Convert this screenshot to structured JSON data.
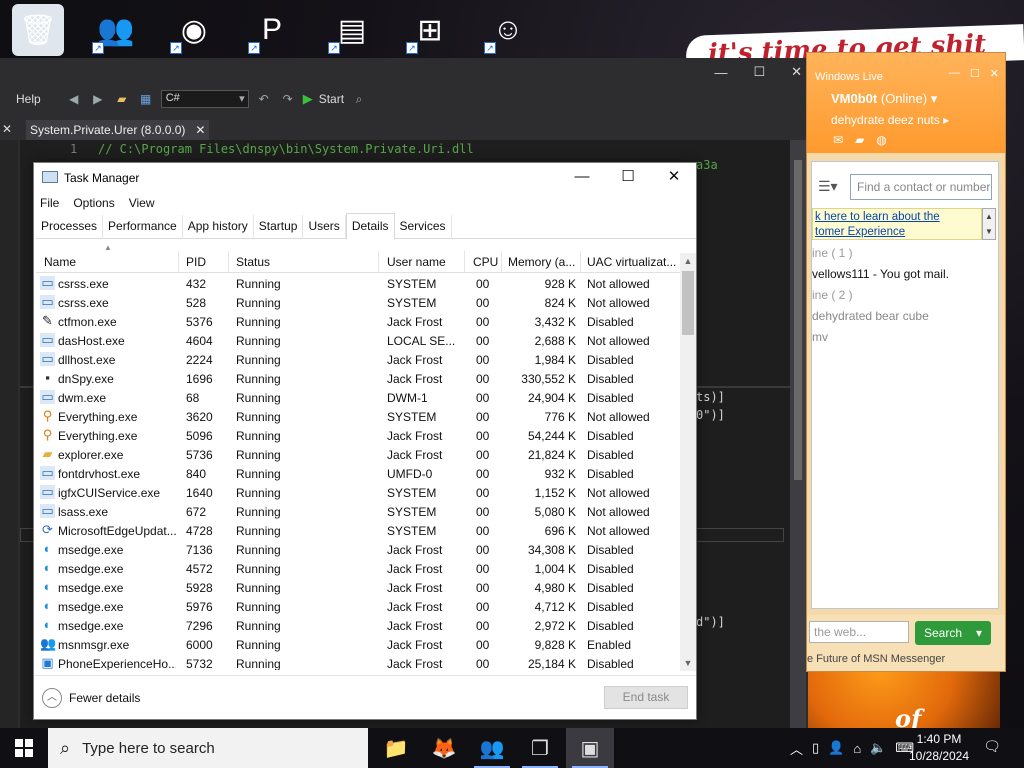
{
  "desktop": {
    "icons": [
      {
        "name": "recycle-bin-icon",
        "glyph": "🗑",
        "bg": "#dfe6ee"
      },
      {
        "name": "msn-messenger-icon",
        "glyph": "👥",
        "bg": "transparent"
      },
      {
        "name": "chrome-icon",
        "glyph": "◉",
        "bg": "transparent"
      },
      {
        "name": "app-p-icon",
        "glyph": "P",
        "bg": "transparent"
      },
      {
        "name": "winrar-icon",
        "glyph": "▤",
        "bg": "transparent"
      },
      {
        "name": "windows-icon",
        "glyph": "⊞",
        "bg": "transparent"
      },
      {
        "name": "character-icon",
        "glyph": "☺",
        "bg": "transparent"
      }
    ],
    "banner_text": "it's time to get shit",
    "pumpkin_text": "of"
  },
  "dnspy": {
    "menu_help": "Help",
    "language": "C#",
    "start_label": "Start",
    "doc_tab": "System.Private.Urer (8.0.0.0)",
    "line_number": "1",
    "comment": "// C:\\Program Files\\dnspy\\bin\\System.Private.Uri.dll",
    "code_fragments": [
      "a3a",
      "ts)]",
      "0\")]",
      "d\")]"
    ]
  },
  "msn": {
    "window_title": "Windows Live",
    "user_name": "VM0b0t",
    "status": "(Online)",
    "personal_message": "dehydrate deez nuts",
    "search_placeholder": "Find a contact or number",
    "ad_line1": "k here to learn about the",
    "ad_line2": "tomer Experience",
    "group_online": "ine ( 1 )",
    "contact_online": "vellows111 - You got mail.",
    "group_offline": "ine ( 2 )",
    "contact_off1": "dehydrated bear cube",
    "contact_off2": "mv",
    "web_search_placeholder": "the web...",
    "search_button": "Search",
    "future_text": "e Future of MSN Messenger"
  },
  "taskmanager": {
    "title": "Task Manager",
    "menu": [
      "File",
      "Options",
      "View"
    ],
    "tabs": [
      "Processes",
      "Performance",
      "App history",
      "Startup",
      "Users",
      "Details",
      "Services"
    ],
    "active_tab": "Details",
    "columns": {
      "name": "Name",
      "pid": "PID",
      "status": "Status",
      "user": "User name",
      "cpu": "CPU",
      "memory": "Memory (a...",
      "uac": "UAC virtualizat..."
    },
    "rows": [
      {
        "name": "csrss.exe",
        "pid": "432",
        "status": "Running",
        "user": "SYSTEM",
        "cpu": "00",
        "mem": "928 K",
        "uac": "Not allowed",
        "icon": "sys"
      },
      {
        "name": "csrss.exe",
        "pid": "528",
        "status": "Running",
        "user": "SYSTEM",
        "cpu": "00",
        "mem": "824 K",
        "uac": "Not allowed",
        "icon": "sys"
      },
      {
        "name": "ctfmon.exe",
        "pid": "5376",
        "status": "Running",
        "user": "Jack Frost",
        "cpu": "00",
        "mem": "3,432 K",
        "uac": "Disabled",
        "icon": "pen"
      },
      {
        "name": "dasHost.exe",
        "pid": "4604",
        "status": "Running",
        "user": "LOCAL SE...",
        "cpu": "00",
        "mem": "2,688 K",
        "uac": "Not allowed",
        "icon": "sys"
      },
      {
        "name": "dllhost.exe",
        "pid": "2224",
        "status": "Running",
        "user": "Jack Frost",
        "cpu": "00",
        "mem": "1,984 K",
        "uac": "Disabled",
        "icon": "sys"
      },
      {
        "name": "dnSpy.exe",
        "pid": "1696",
        "status": "Running",
        "user": "Jack Frost",
        "cpu": "00",
        "mem": "330,552 K",
        "uac": "Disabled",
        "icon": "dnspy"
      },
      {
        "name": "dwm.exe",
        "pid": "68",
        "status": "Running",
        "user": "DWM-1",
        "cpu": "00",
        "mem": "24,904 K",
        "uac": "Disabled",
        "icon": "sys"
      },
      {
        "name": "Everything.exe",
        "pid": "3620",
        "status": "Running",
        "user": "SYSTEM",
        "cpu": "00",
        "mem": "776 K",
        "uac": "Not allowed",
        "icon": "search"
      },
      {
        "name": "Everything.exe",
        "pid": "5096",
        "status": "Running",
        "user": "Jack Frost",
        "cpu": "00",
        "mem": "54,244 K",
        "uac": "Disabled",
        "icon": "search"
      },
      {
        "name": "explorer.exe",
        "pid": "5736",
        "status": "Running",
        "user": "Jack Frost",
        "cpu": "00",
        "mem": "21,824 K",
        "uac": "Disabled",
        "icon": "folder"
      },
      {
        "name": "fontdrvhost.exe",
        "pid": "840",
        "status": "Running",
        "user": "UMFD-0",
        "cpu": "00",
        "mem": "932 K",
        "uac": "Disabled",
        "icon": "sys"
      },
      {
        "name": "igfxCUIService.exe",
        "pid": "1640",
        "status": "Running",
        "user": "SYSTEM",
        "cpu": "00",
        "mem": "1,152 K",
        "uac": "Not allowed",
        "icon": "sys"
      },
      {
        "name": "lsass.exe",
        "pid": "672",
        "status": "Running",
        "user": "SYSTEM",
        "cpu": "00",
        "mem": "5,080 K",
        "uac": "Not allowed",
        "icon": "sys"
      },
      {
        "name": "MicrosoftEdgeUpdat...",
        "pid": "4728",
        "status": "Running",
        "user": "SYSTEM",
        "cpu": "00",
        "mem": "696 K",
        "uac": "Not allowed",
        "icon": "update"
      },
      {
        "name": "msedge.exe",
        "pid": "7136",
        "status": "Running",
        "user": "Jack Frost",
        "cpu": "00",
        "mem": "34,308 K",
        "uac": "Disabled",
        "icon": "edge"
      },
      {
        "name": "msedge.exe",
        "pid": "4572",
        "status": "Running",
        "user": "Jack Frost",
        "cpu": "00",
        "mem": "1,004 K",
        "uac": "Disabled",
        "icon": "edge"
      },
      {
        "name": "msedge.exe",
        "pid": "5928",
        "status": "Running",
        "user": "Jack Frost",
        "cpu": "00",
        "mem": "4,980 K",
        "uac": "Disabled",
        "icon": "edge"
      },
      {
        "name": "msedge.exe",
        "pid": "5976",
        "status": "Running",
        "user": "Jack Frost",
        "cpu": "00",
        "mem": "4,712 K",
        "uac": "Disabled",
        "icon": "edge"
      },
      {
        "name": "msedge.exe",
        "pid": "7296",
        "status": "Running",
        "user": "Jack Frost",
        "cpu": "00",
        "mem": "2,972 K",
        "uac": "Disabled",
        "icon": "edge"
      },
      {
        "name": "msnmsgr.exe",
        "pid": "6000",
        "status": "Running",
        "user": "Jack Frost",
        "cpu": "00",
        "mem": "9,828 K",
        "uac": "Enabled",
        "icon": "msn"
      },
      {
        "name": "PhoneExperienceHo...",
        "pid": "5732",
        "status": "Running",
        "user": "Jack Frost",
        "cpu": "00",
        "mem": "25,184 K",
        "uac": "Disabled",
        "icon": "phone"
      }
    ],
    "fewer_details": "Fewer details",
    "end_task": "End task"
  },
  "taskbar": {
    "search_placeholder": "Type here to search",
    "apps": [
      {
        "name": "file-explorer-icon",
        "glyph": "📁",
        "running": false,
        "active": false
      },
      {
        "name": "firefox-icon",
        "glyph": "🦊",
        "running": false,
        "active": false
      },
      {
        "name": "msn-taskbar-icon",
        "glyph": "👥",
        "running": true,
        "active": false
      },
      {
        "name": "task-view-icon",
        "glyph": "❐",
        "running": true,
        "active": false
      },
      {
        "name": "task-manager-taskbar-icon",
        "glyph": "▣",
        "running": true,
        "active": true
      }
    ],
    "time": "1:40 PM",
    "date": "10/28/2024"
  },
  "colors": {
    "msn_orange": "#ff9a2e",
    "dnspy_bg": "#1e1e1e",
    "search_green": "#2e9a3a",
    "edge_blue": "#1f8fd6"
  }
}
